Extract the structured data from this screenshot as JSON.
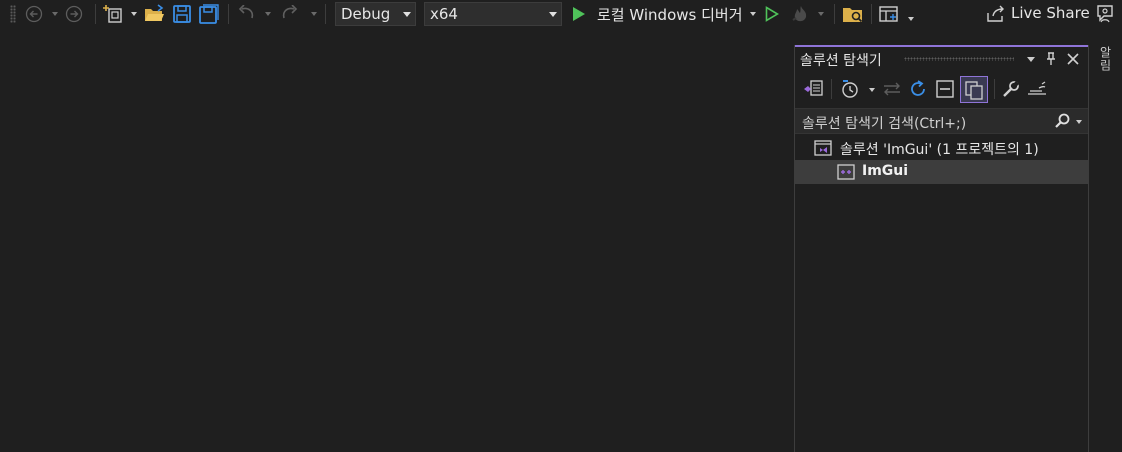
{
  "toolbar": {
    "configuration": "Debug",
    "platform": "x64",
    "debugger_label": "로컬 Windows 디버거",
    "live_share_label": "Live Share"
  },
  "solution_explorer": {
    "title": "솔루션 탐색기",
    "search_placeholder": "솔루션 탐색기 검색(Ctrl+;)",
    "solution_label": "솔루션 'ImGui'  (1 프로젝트의 1)",
    "project_label": "ImGui"
  },
  "right_strip": {
    "label": "알림"
  },
  "colors": {
    "background": "#1f1f1f",
    "accent": "#8f74d8",
    "run_green": "#4fc25a",
    "save_blue": "#3a8ee6",
    "folder_yellow": "#dcb04a"
  },
  "icons": [
    "back-icon",
    "forward-icon",
    "new-project-icon",
    "open-folder-icon",
    "save-icon",
    "save-all-icon",
    "undo-icon",
    "redo-icon",
    "run-icon",
    "run-no-debug-icon",
    "hot-reload-icon",
    "file-explorer-icon",
    "layout-icon",
    "live-share-icon",
    "feedback-icon"
  ]
}
